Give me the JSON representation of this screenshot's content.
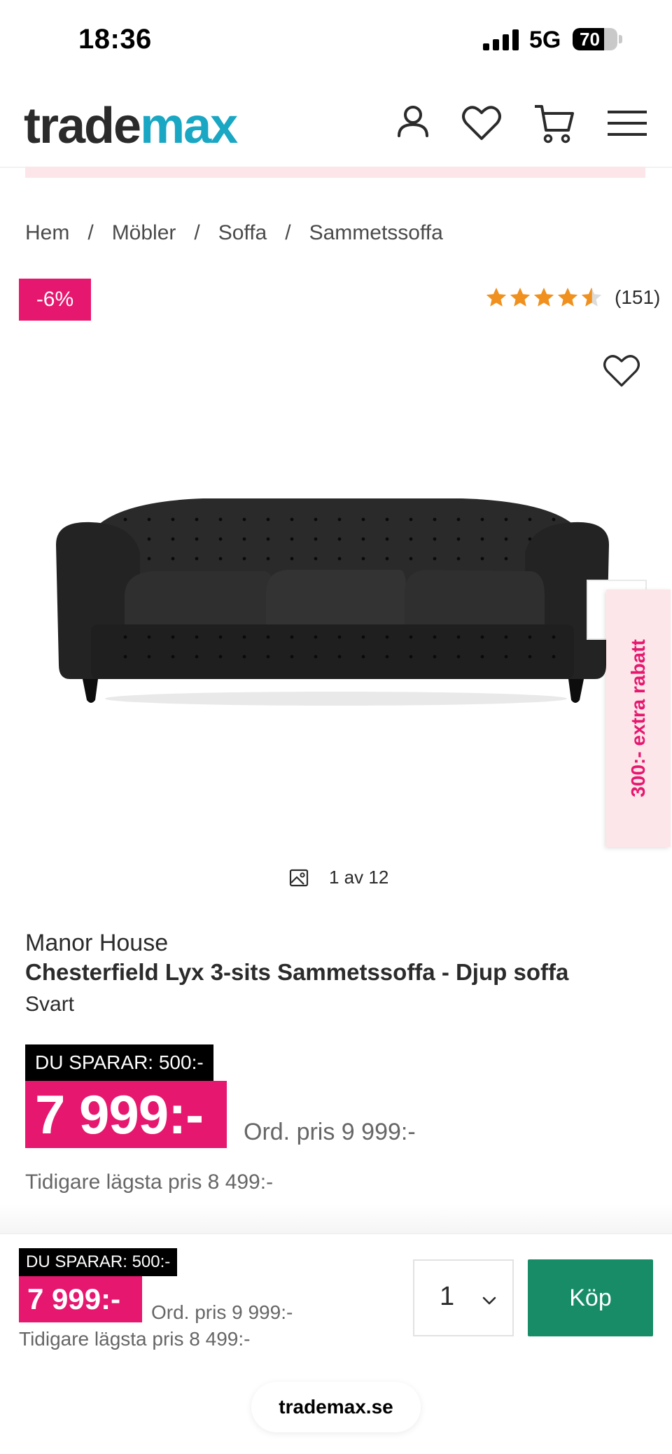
{
  "status_bar": {
    "time": "18:36",
    "network": "5G",
    "battery": "70",
    "battery_level": 0.7
  },
  "header": {
    "logo_part1": "trade",
    "logo_part2": "max",
    "icons": [
      "user-icon",
      "heart-icon",
      "cart-icon",
      "menu-icon"
    ]
  },
  "breadcrumb": {
    "items": [
      "Hem",
      "Möbler",
      "Soffa",
      "Sammetssoffa"
    ],
    "separator": "/"
  },
  "product": {
    "discount_badge": "-6%",
    "rating_value": 4.5,
    "rating_count": "(151)",
    "image_counter": "1 av 12",
    "extra_discount_tab": "300:- extra rabatt",
    "brand": "Manor House",
    "title": "Chesterfield Lyx 3-sits Sammetssoffa - Djup soffa",
    "color": "Svart",
    "save_tag": "DU SPARAR: 500:-",
    "price": "7 999:-",
    "ordinary_price": "Ord. pris 9 999:-",
    "lowest_price": "Tidigare lägsta pris 8 499:-"
  },
  "sticky_bar": {
    "save_tag": "DU SPARAR: 500:-",
    "price": "7 999:-",
    "ordinary_price": "Ord. pris 9 999:-",
    "lowest_price": "Tidigare lägsta pris 8 499:-",
    "quantity": "1",
    "buy_label": "Köp"
  },
  "browser": {
    "url": "trademax.se"
  },
  "colors": {
    "brand_pink": "#e6176e",
    "brand_teal": "#19a7c4",
    "buy_green": "#188c67",
    "promo_pink_bg": "#fde6ea",
    "star_orange": "#f0901e"
  }
}
